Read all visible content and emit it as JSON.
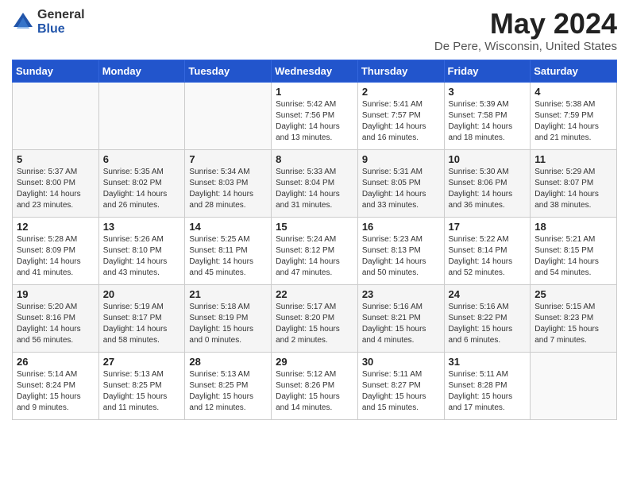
{
  "header": {
    "logo_general": "General",
    "logo_blue": "Blue",
    "month_title": "May 2024",
    "location": "De Pere, Wisconsin, United States"
  },
  "days_of_week": [
    "Sunday",
    "Monday",
    "Tuesday",
    "Wednesday",
    "Thursday",
    "Friday",
    "Saturday"
  ],
  "weeks": [
    [
      {
        "day": "",
        "info": ""
      },
      {
        "day": "",
        "info": ""
      },
      {
        "day": "",
        "info": ""
      },
      {
        "day": "1",
        "info": "Sunrise: 5:42 AM\nSunset: 7:56 PM\nDaylight: 14 hours\nand 13 minutes."
      },
      {
        "day": "2",
        "info": "Sunrise: 5:41 AM\nSunset: 7:57 PM\nDaylight: 14 hours\nand 16 minutes."
      },
      {
        "day": "3",
        "info": "Sunrise: 5:39 AM\nSunset: 7:58 PM\nDaylight: 14 hours\nand 18 minutes."
      },
      {
        "day": "4",
        "info": "Sunrise: 5:38 AM\nSunset: 7:59 PM\nDaylight: 14 hours\nand 21 minutes."
      }
    ],
    [
      {
        "day": "5",
        "info": "Sunrise: 5:37 AM\nSunset: 8:00 PM\nDaylight: 14 hours\nand 23 minutes."
      },
      {
        "day": "6",
        "info": "Sunrise: 5:35 AM\nSunset: 8:02 PM\nDaylight: 14 hours\nand 26 minutes."
      },
      {
        "day": "7",
        "info": "Sunrise: 5:34 AM\nSunset: 8:03 PM\nDaylight: 14 hours\nand 28 minutes."
      },
      {
        "day": "8",
        "info": "Sunrise: 5:33 AM\nSunset: 8:04 PM\nDaylight: 14 hours\nand 31 minutes."
      },
      {
        "day": "9",
        "info": "Sunrise: 5:31 AM\nSunset: 8:05 PM\nDaylight: 14 hours\nand 33 minutes."
      },
      {
        "day": "10",
        "info": "Sunrise: 5:30 AM\nSunset: 8:06 PM\nDaylight: 14 hours\nand 36 minutes."
      },
      {
        "day": "11",
        "info": "Sunrise: 5:29 AM\nSunset: 8:07 PM\nDaylight: 14 hours\nand 38 minutes."
      }
    ],
    [
      {
        "day": "12",
        "info": "Sunrise: 5:28 AM\nSunset: 8:09 PM\nDaylight: 14 hours\nand 41 minutes."
      },
      {
        "day": "13",
        "info": "Sunrise: 5:26 AM\nSunset: 8:10 PM\nDaylight: 14 hours\nand 43 minutes."
      },
      {
        "day": "14",
        "info": "Sunrise: 5:25 AM\nSunset: 8:11 PM\nDaylight: 14 hours\nand 45 minutes."
      },
      {
        "day": "15",
        "info": "Sunrise: 5:24 AM\nSunset: 8:12 PM\nDaylight: 14 hours\nand 47 minutes."
      },
      {
        "day": "16",
        "info": "Sunrise: 5:23 AM\nSunset: 8:13 PM\nDaylight: 14 hours\nand 50 minutes."
      },
      {
        "day": "17",
        "info": "Sunrise: 5:22 AM\nSunset: 8:14 PM\nDaylight: 14 hours\nand 52 minutes."
      },
      {
        "day": "18",
        "info": "Sunrise: 5:21 AM\nSunset: 8:15 PM\nDaylight: 14 hours\nand 54 minutes."
      }
    ],
    [
      {
        "day": "19",
        "info": "Sunrise: 5:20 AM\nSunset: 8:16 PM\nDaylight: 14 hours\nand 56 minutes."
      },
      {
        "day": "20",
        "info": "Sunrise: 5:19 AM\nSunset: 8:17 PM\nDaylight: 14 hours\nand 58 minutes."
      },
      {
        "day": "21",
        "info": "Sunrise: 5:18 AM\nSunset: 8:19 PM\nDaylight: 15 hours\nand 0 minutes."
      },
      {
        "day": "22",
        "info": "Sunrise: 5:17 AM\nSunset: 8:20 PM\nDaylight: 15 hours\nand 2 minutes."
      },
      {
        "day": "23",
        "info": "Sunrise: 5:16 AM\nSunset: 8:21 PM\nDaylight: 15 hours\nand 4 minutes."
      },
      {
        "day": "24",
        "info": "Sunrise: 5:16 AM\nSunset: 8:22 PM\nDaylight: 15 hours\nand 6 minutes."
      },
      {
        "day": "25",
        "info": "Sunrise: 5:15 AM\nSunset: 8:23 PM\nDaylight: 15 hours\nand 7 minutes."
      }
    ],
    [
      {
        "day": "26",
        "info": "Sunrise: 5:14 AM\nSunset: 8:24 PM\nDaylight: 15 hours\nand 9 minutes."
      },
      {
        "day": "27",
        "info": "Sunrise: 5:13 AM\nSunset: 8:25 PM\nDaylight: 15 hours\nand 11 minutes."
      },
      {
        "day": "28",
        "info": "Sunrise: 5:13 AM\nSunset: 8:25 PM\nDaylight: 15 hours\nand 12 minutes."
      },
      {
        "day": "29",
        "info": "Sunrise: 5:12 AM\nSunset: 8:26 PM\nDaylight: 15 hours\nand 14 minutes."
      },
      {
        "day": "30",
        "info": "Sunrise: 5:11 AM\nSunset: 8:27 PM\nDaylight: 15 hours\nand 15 minutes."
      },
      {
        "day": "31",
        "info": "Sunrise: 5:11 AM\nSunset: 8:28 PM\nDaylight: 15 hours\nand 17 minutes."
      },
      {
        "day": "",
        "info": ""
      }
    ]
  ]
}
